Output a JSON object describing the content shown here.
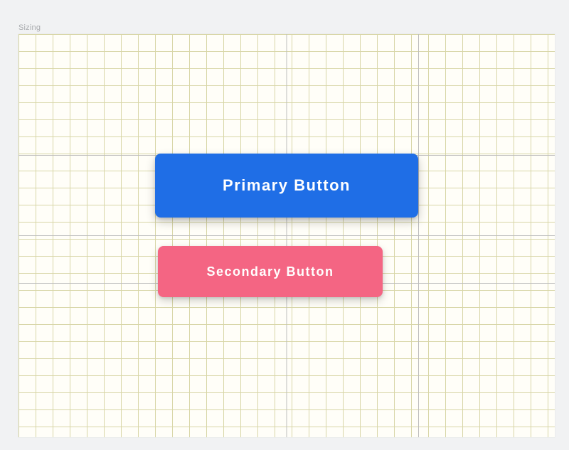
{
  "frame": {
    "label": "Sizing"
  },
  "buttons": {
    "primary": {
      "label": "Primary Button"
    },
    "secondary": {
      "label": "Secondary Button"
    }
  }
}
